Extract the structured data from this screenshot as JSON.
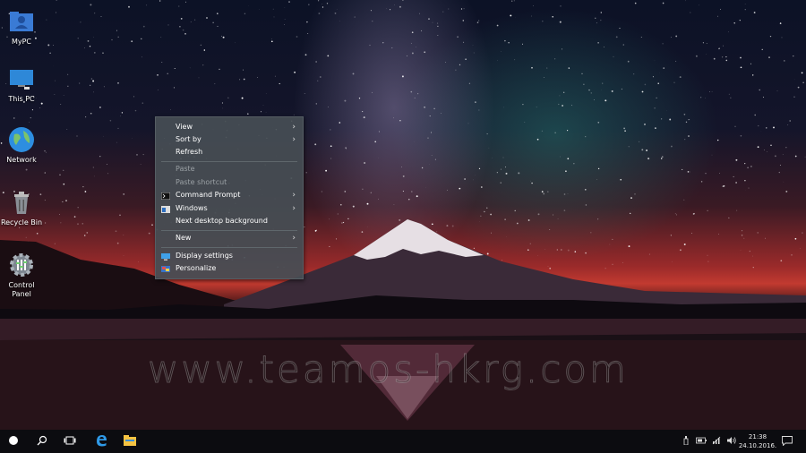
{
  "desktop": {
    "icons": [
      {
        "label": "MyPC"
      },
      {
        "label": "This PC"
      },
      {
        "label": "Network"
      },
      {
        "label": "Recycle Bin"
      },
      {
        "label": "Control Panel"
      }
    ],
    "watermark": "www.teamos-hkrg.com"
  },
  "context_menu": {
    "items": [
      {
        "label": "View"
      },
      {
        "label": "Sort by"
      },
      {
        "label": "Refresh"
      },
      {
        "label": "Paste"
      },
      {
        "label": "Paste shortcut"
      },
      {
        "label": "Command Prompt"
      },
      {
        "label": "Windows"
      },
      {
        "label": "Next desktop background"
      },
      {
        "label": "New"
      },
      {
        "label": "Display settings"
      },
      {
        "label": "Personalize"
      }
    ]
  },
  "taskbar": {
    "buttons": [
      "start-icon",
      "search-icon",
      "task-view-icon",
      "edge-icon",
      "file-explorer-icon"
    ],
    "clock_time": "21:38",
    "clock_date": "24.10.2016."
  }
}
